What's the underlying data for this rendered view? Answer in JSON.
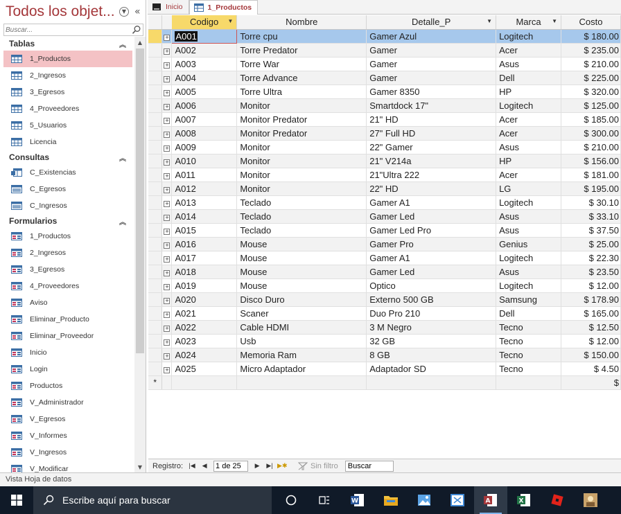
{
  "nav": {
    "title": "Todos los objet...",
    "search_placeholder": "Buscar...",
    "groups": [
      {
        "label": "Tablas",
        "items": [
          "1_Productos",
          "2_Ingresos",
          "3_Egresos",
          "4_Proveedores",
          "5_Usuarios",
          "Licencia"
        ]
      },
      {
        "label": "Consultas",
        "items": [
          "C_Existencias",
          "C_Egresos",
          "C_Ingresos"
        ]
      },
      {
        "label": "Formularios",
        "items": [
          "1_Productos",
          "2_Ingresos",
          "3_Egresos",
          "4_Proveedores",
          "Aviso",
          "Eliminar_Producto",
          "Eliminar_Proveedor",
          "Inicio",
          "Login",
          "Productos",
          "V_Administrador",
          "V_Egresos",
          "V_Informes",
          "V_Ingresos",
          "V_Modificar"
        ]
      }
    ]
  },
  "tabs": [
    {
      "label": "Inicio",
      "active": false
    },
    {
      "label": "1_Productos",
      "active": true
    }
  ],
  "grid": {
    "columns": [
      "Codigo",
      "Nombre",
      "Detalle_P",
      "Marca",
      "Costo"
    ],
    "rows": [
      [
        "A001",
        "Torre cpu",
        "Gamer Azul",
        "Logitech",
        "$ 180.00"
      ],
      [
        "A002",
        "Torre Predator",
        "Gamer",
        "Acer",
        "$ 235.00"
      ],
      [
        "A003",
        "Torre War",
        "Gamer",
        "Asus",
        "$ 210.00"
      ],
      [
        "A004",
        "Torre Advance",
        "Gamer",
        "Dell",
        "$ 225.00"
      ],
      [
        "A005",
        "Torre Ultra",
        "Gamer 8350",
        "HP",
        "$ 320.00"
      ],
      [
        "A006",
        "Monitor",
        "Smartdock 17\"",
        "Logitech",
        "$ 125.00"
      ],
      [
        "A007",
        "Monitor Predator",
        "21\" HD",
        "Acer",
        "$ 185.00"
      ],
      [
        "A008",
        "Monitor Predator",
        "27\" Full HD",
        "Acer",
        "$ 300.00"
      ],
      [
        "A009",
        "Monitor",
        "22\" Gamer",
        "Asus",
        "$ 210.00"
      ],
      [
        "A010",
        "Monitor",
        "21\" V214a",
        "HP",
        "$ 156.00"
      ],
      [
        "A011",
        "Monitor",
        "21\"Ultra 222",
        "Acer",
        "$ 181.00"
      ],
      [
        "A012",
        "Monitor",
        "22\" HD",
        "LG",
        "$ 195.00"
      ],
      [
        "A013",
        "Teclado",
        "Gamer A1",
        "Logitech",
        "$ 30.10"
      ],
      [
        "A014",
        "Teclado",
        "Gamer Led",
        "Asus",
        "$ 33.10"
      ],
      [
        "A015",
        "Teclado",
        "Gamer Led Pro",
        "Asus",
        "$ 37.50"
      ],
      [
        "A016",
        "Mouse",
        "Gamer Pro",
        "Genius",
        "$ 25.00"
      ],
      [
        "A017",
        "Mouse",
        "Gamer A1",
        "Logitech",
        "$ 22.30"
      ],
      [
        "A018",
        "Mouse",
        "Gamer Led",
        "Asus",
        "$ 23.50"
      ],
      [
        "A019",
        "Mouse",
        "Optico",
        "Logitech",
        "$ 12.00"
      ],
      [
        "A020",
        "Disco Duro",
        "Externo 500 GB",
        "Samsung",
        "$ 178.90"
      ],
      [
        "A021",
        "Scaner",
        "Duo Pro 210",
        "Dell",
        "$ 165.00"
      ],
      [
        "A022",
        "Cable HDMI",
        "3 M Negro",
        "Tecno",
        "$ 12.50"
      ],
      [
        "A023",
        "Usb",
        "32 GB",
        "Tecno",
        "$ 12.00"
      ],
      [
        "A024",
        "Memoria Ram",
        "8 GB",
        "Tecno",
        "$ 150.00"
      ],
      [
        "A025",
        "Micro Adaptador",
        "Adaptador SD",
        "Tecno",
        "$ 4.50"
      ]
    ],
    "new_row_marker": "*",
    "new_row_cost": "$"
  },
  "record_nav": {
    "label": "Registro:",
    "position": "1 de 25",
    "filter": "Sin filtro",
    "search": "Buscar"
  },
  "status": "Vista Hoja de datos",
  "taskbar": {
    "search_placeholder": "Escribe aquí para buscar"
  }
}
